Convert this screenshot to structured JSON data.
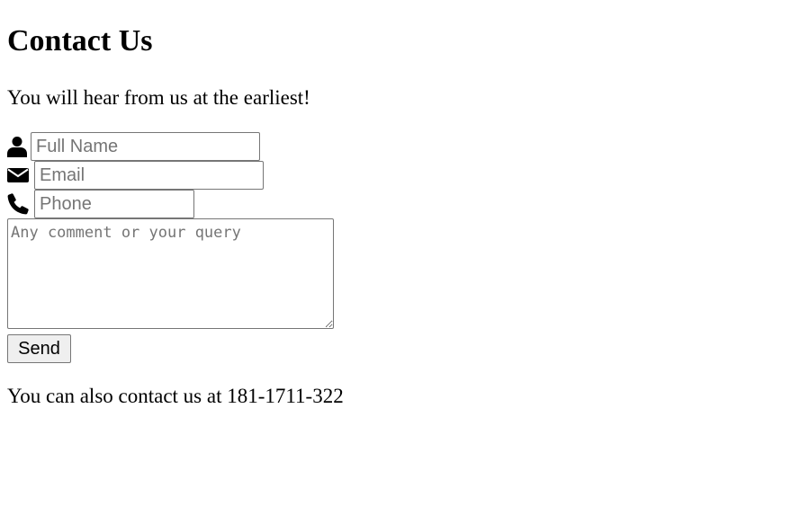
{
  "page": {
    "title": "Contact Us",
    "subtitle": "You will hear from us at the earliest!",
    "footer": "You can also contact us at 181-1711-322"
  },
  "form": {
    "name": {
      "icon": "user-icon",
      "placeholder": "Full Name",
      "value": ""
    },
    "email": {
      "icon": "envelope-icon",
      "placeholder": "Email",
      "value": ""
    },
    "phone": {
      "icon": "phone-icon",
      "placeholder": "Phone",
      "value": ""
    },
    "comment": {
      "placeholder": "Any comment or your query",
      "value": ""
    },
    "send_label": "Send"
  }
}
